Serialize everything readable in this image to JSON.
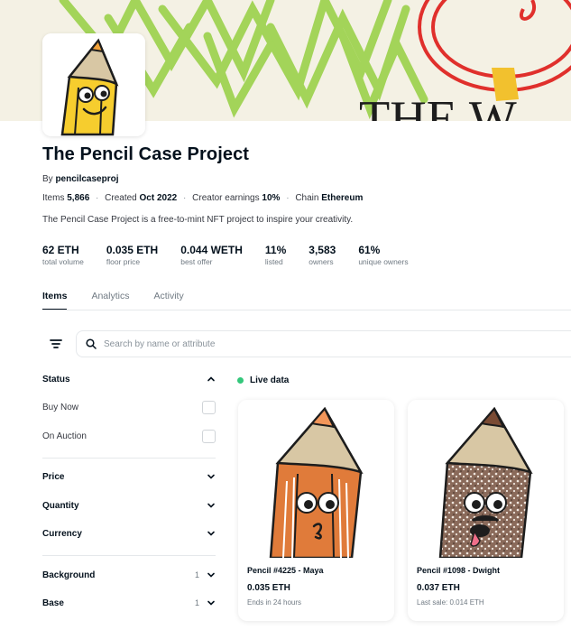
{
  "collection": {
    "title": "The Pencil Case Project",
    "by_prefix": "By",
    "creator": "pencilcaseproj",
    "items_label": "Items",
    "items_value": "5,866",
    "created_label": "Created",
    "created_value": "Oct 2022",
    "earnings_label": "Creator earnings",
    "earnings_value": "10%",
    "chain_label": "Chain",
    "chain_value": "Ethereum",
    "separator": "·",
    "description": "The Pencil Case Project is a free-to-mint NFT project to inspire your creativity."
  },
  "banner": {
    "text": "THE W"
  },
  "stats": [
    {
      "value": "62 ETH",
      "label": "total volume"
    },
    {
      "value": "0.035 ETH",
      "label": "floor price"
    },
    {
      "value": "0.044 WETH",
      "label": "best offer"
    },
    {
      "value": "11%",
      "label": "listed"
    },
    {
      "value": "3,583",
      "label": "owners"
    },
    {
      "value": "61%",
      "label": "unique owners"
    }
  ],
  "tabs": [
    "Items",
    "Analytics",
    "Activity"
  ],
  "search": {
    "placeholder": "Search by name or attribute"
  },
  "filters": {
    "status_label": "Status",
    "buy_now_label": "Buy Now",
    "on_auction_label": "On Auction",
    "price_label": "Price",
    "quantity_label": "Quantity",
    "currency_label": "Currency",
    "background_label": "Background",
    "background_count": "1",
    "base_label": "Base",
    "base_count": "1"
  },
  "live_label": "Live data",
  "items": [
    {
      "name": "Pencil #4225 - Maya",
      "price": "0.035 ETH",
      "sub": "Ends in 24 hours"
    },
    {
      "name": "Pencil #1098 - Dwight",
      "price": "0.037 ETH",
      "sub": "Last sale: 0.014 ETH"
    }
  ],
  "colors": {
    "accent": "#2081e2",
    "live": "#34c77b",
    "banner_bg": "#f4f1e4",
    "pencil_yellow": "#f6cd2e",
    "pencil_orange": "#e07b3a"
  },
  "icons": [
    "filter-icon",
    "search-icon",
    "chevron-up-icon",
    "chevron-down-icon"
  ]
}
